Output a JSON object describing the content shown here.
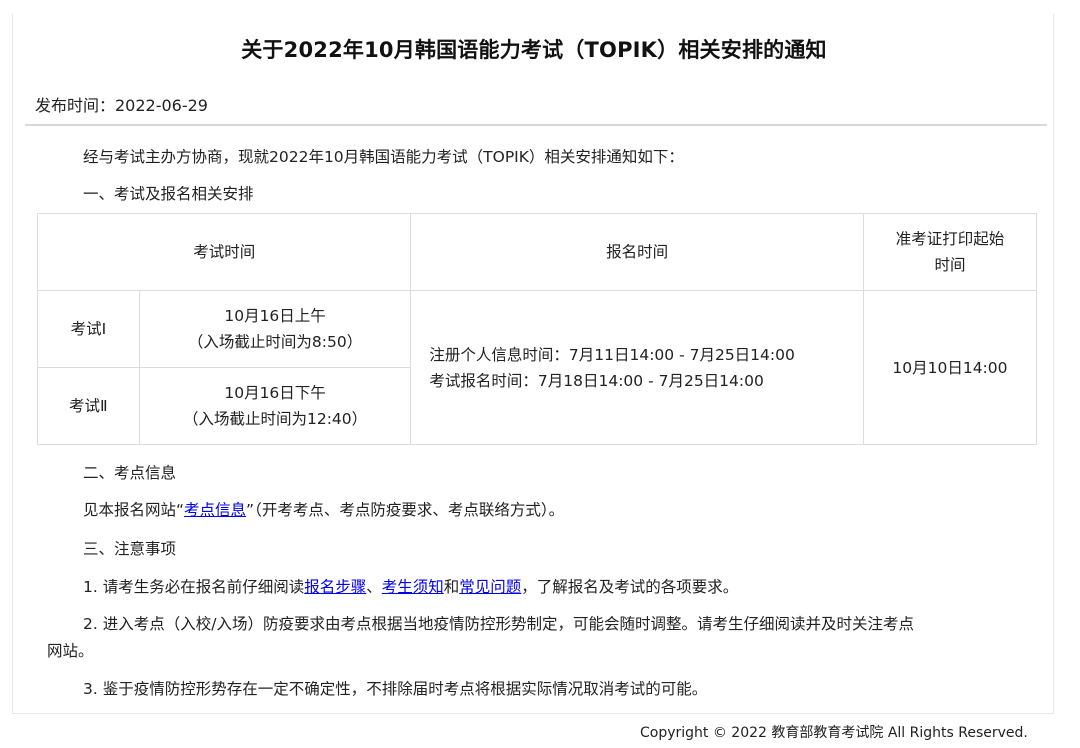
{
  "notice": {
    "title": "关于2022年10月韩国语能力考试（TOPIK）相关安排的通知",
    "publish_date": "发布时间：2022-06-29",
    "intro": "经与考试主办方协商，现就2022年10月韩国语能力考试（TOPIK）相关安排通知如下：",
    "section1": "一、考试及报名相关安排",
    "table": {
      "headers": {
        "exam_time": "考试时间",
        "registration_time": "报名时间",
        "admission_print_line1": "准考证打印起始",
        "admission_print_line2": "时间"
      },
      "rows": [
        {
          "label": "考试Ⅰ",
          "time_line1": "10月16日上午",
          "time_line2": "（入场截止时间为8:50）"
        },
        {
          "label": "考试Ⅱ",
          "time_line1": "10月16日下午",
          "time_line2": "（入场截止时间为12:40）"
        }
      ],
      "registration_line1": "注册个人信息时间：7月11日14:00 - 7月25日14:00",
      "registration_line2": "考试报名时间：7月18日14:00 - 7月25日14:00",
      "admission_print": "10月10日14:00"
    },
    "section2": "二、考点信息",
    "section2_body": {
      "prefix": "见本报名网站“",
      "link": "考点信息",
      "suffix": "”（开考考点、考点防疫要求、考点联络方式）。"
    },
    "section3": "三、注意事项",
    "note1": {
      "prefix": "1. 请考生务必在报名前仔细阅读",
      "link1": "报名步骤",
      "sep1": "、",
      "link2": "考生须知",
      "sep2": "和",
      "link3": "常见问题",
      "suffix": "，了解报名及考试的各项要求。"
    },
    "note2_line1": "2. 进入考点（入校/入场）防疫要求由考点根据当地疫情防控形势制定，可能会随时调整。请考生仔细阅读并及时关注考点",
    "note2_line2": "网站。",
    "note3": "3. 鉴于疫情防控形势存在一定不确定性，不排除届时考点将根据实际情况取消考试的可能。"
  },
  "footer": {
    "copyright": "Copyright © 2022 教育部教育考试院 All Rights Reserved."
  },
  "colors": {
    "link": "#0000ee",
    "divider": "#d9d9d9",
    "table_border": "#dcdcdc"
  }
}
